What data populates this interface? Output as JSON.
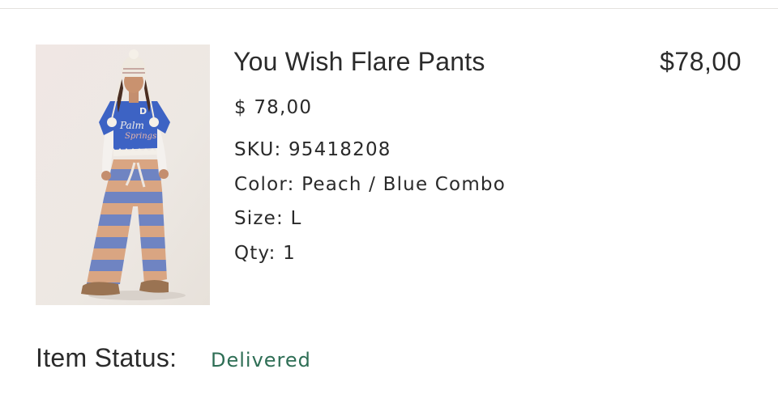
{
  "order_item": {
    "product_name": "You Wish Flare Pants",
    "line_total": "$78,00",
    "unit_price": "$ 78,00",
    "sku": "SKU: 95418208",
    "color": "Color: Peach / Blue Combo",
    "size": "Size: L",
    "qty": "Qty: 1"
  },
  "status": {
    "label": "Item Status:",
    "value": "Delivered",
    "value_color": "#2e6e55"
  },
  "thumbnail": {
    "icon": "product-photo"
  }
}
